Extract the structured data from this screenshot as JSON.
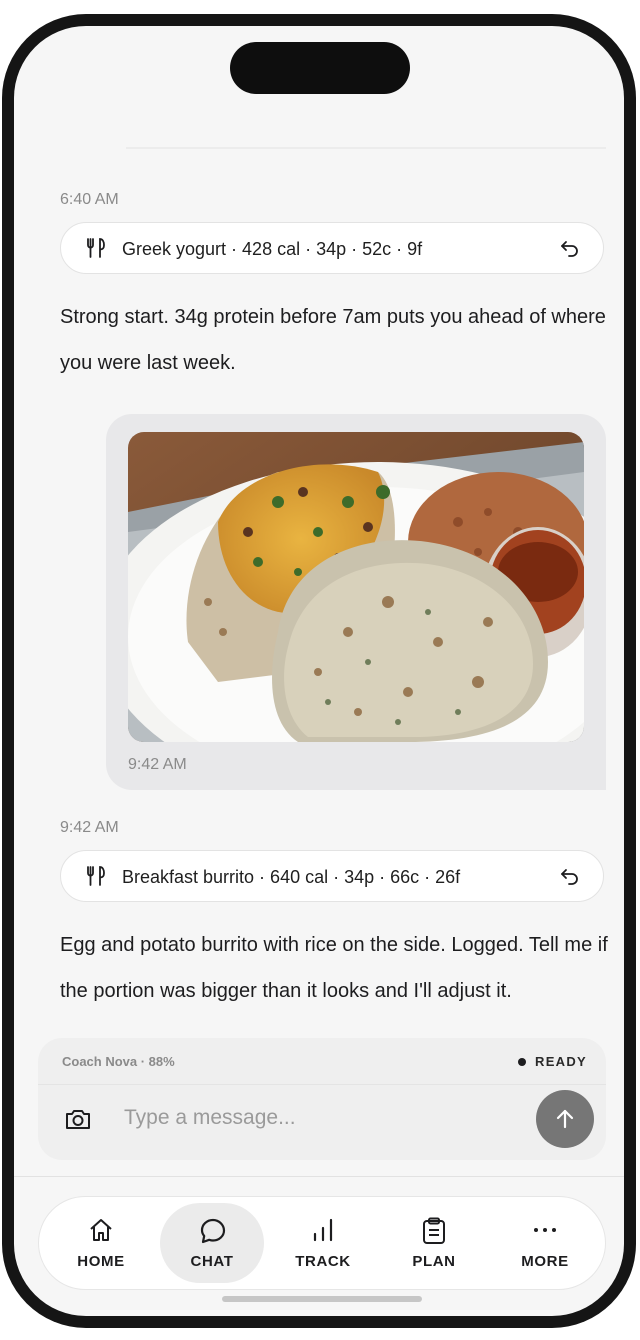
{
  "timeline": [
    {
      "timestamp": "6:40 AM",
      "log": {
        "icon": "fork-knife-icon",
        "text": "Greek yogurt · 428 cal · 34p · 52c · 9f",
        "undo_icon": "undo-icon"
      },
      "coach_reply": "Strong start. 34g protein before 7am puts you ahead of where you were last week."
    },
    {
      "photo_message": {
        "image": "breakfast-burrito-photo",
        "timestamp": "9:42 AM"
      }
    },
    {
      "timestamp": "9:42 AM",
      "log": {
        "icon": "fork-knife-icon",
        "text": "Breakfast burrito · 640 cal · 34p · 66c · 26f",
        "undo_icon": "undo-icon"
      },
      "coach_reply": "Egg and potato burrito with rice on the side. Logged. Tell me if the portion was bigger than it looks and I'll adjust it."
    }
  ],
  "composer": {
    "coach_status": "Coach Nova · 88%",
    "ready_label": "READY",
    "placeholder": "Type a message...",
    "camera_icon": "camera-icon",
    "send_icon": "arrow-up-icon"
  },
  "tabbar": {
    "active": "CHAT",
    "tabs": [
      {
        "label": "HOME",
        "icon": "home-icon"
      },
      {
        "label": "CHAT",
        "icon": "chat-bubble-icon"
      },
      {
        "label": "TRACK",
        "icon": "bar-chart-icon"
      },
      {
        "label": "PLAN",
        "icon": "clipboard-icon"
      },
      {
        "label": "MORE",
        "icon": "more-dots-icon"
      }
    ]
  },
  "colors": {
    "accent_dark": "#1d1d1f",
    "send_button": "#767676",
    "bubble": "#e8e8ea"
  }
}
